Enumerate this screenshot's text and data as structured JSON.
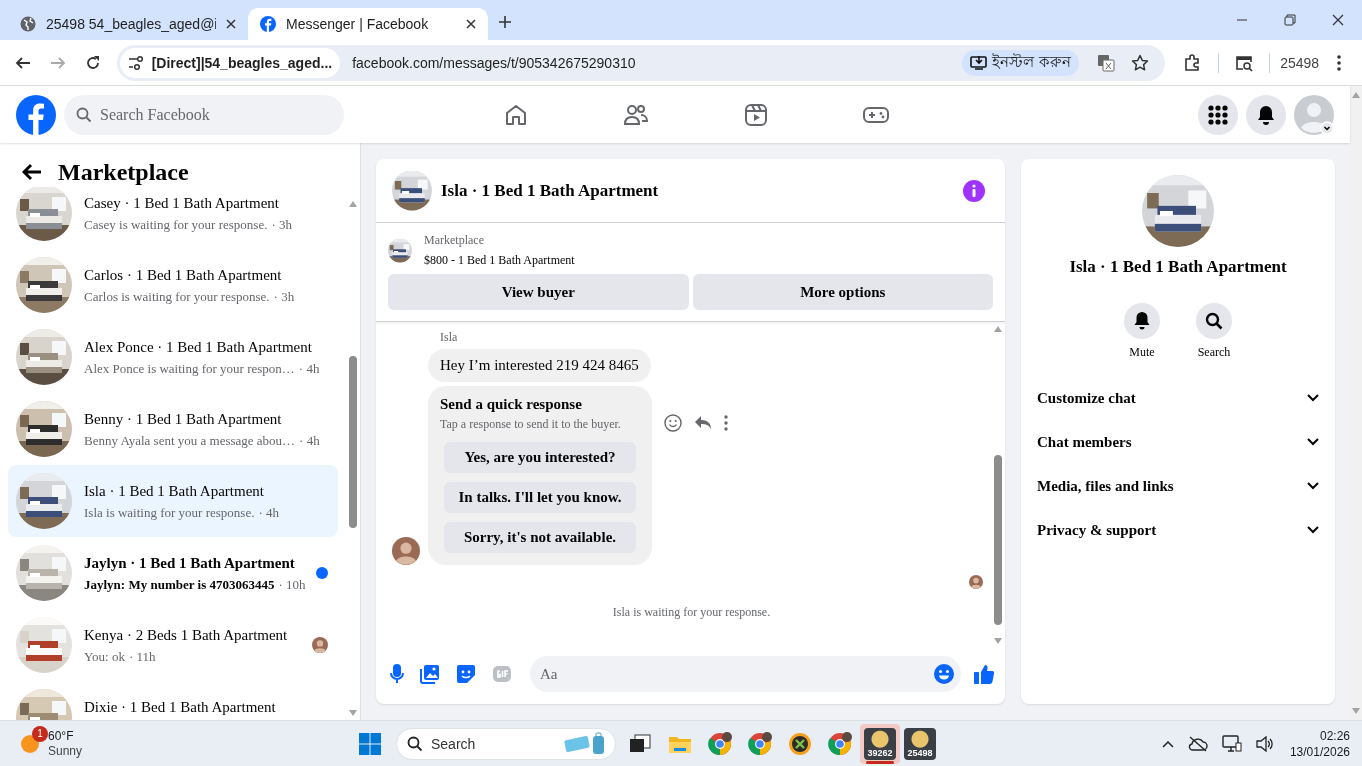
{
  "browser": {
    "tabs": [
      {
        "title": "25498 54_beagles_aged@i",
        "kind": "globe",
        "selected": false
      },
      {
        "title": "Messenger | Facebook",
        "kind": "site",
        "selected": true
      }
    ],
    "site_chip": "[Direct]|54_beagles_aged...",
    "url": "facebook.com/messages/t/905342675290310",
    "install_button": "ইনস্টল করুন",
    "profile_label": "25498"
  },
  "header": {
    "search": {
      "placeholder": "Search Facebook"
    }
  },
  "sidebar": {
    "title": "Marketplace",
    "conversations": [
      {
        "name": "Casey · 1 Bed 1 Bath Apartment",
        "preview": "Casey is waiting for your response.",
        "time": "· 3h",
        "selected": false,
        "unread": false,
        "seen": false
      },
      {
        "name": "Carlos · 1 Bed 1 Bath Apartment",
        "preview": "Carlos is waiting for your response.",
        "time": "· 3h",
        "selected": false,
        "unread": false,
        "seen": false
      },
      {
        "name": "Alex Ponce · 1 Bed 1 Bath Apartment",
        "preview": "Alex Ponce is waiting for your respon…",
        "time": "· 4h",
        "selected": false,
        "unread": false,
        "seen": false
      },
      {
        "name": "Benny · 1 Bed 1 Bath Apartment",
        "preview": "Benny Ayala sent you a message abou…",
        "time": "· 4h",
        "selected": false,
        "unread": false,
        "seen": false
      },
      {
        "name": "Isla · 1 Bed 1 Bath Apartment",
        "preview": "Isla is waiting for your response.",
        "time": "· 4h",
        "selected": true,
        "unread": false,
        "seen": false
      },
      {
        "name": "Jaylyn · 1 Bed 1 Bath Apartment",
        "preview": "Jaylyn: My number is 4703063445",
        "time": "· 10h",
        "selected": false,
        "unread": true,
        "seen": false
      },
      {
        "name": "Kenya · 2 Beds 1 Bath Apartment",
        "preview": "You: ok",
        "time": "· 11h",
        "selected": false,
        "unread": false,
        "seen": true
      },
      {
        "name": "Dixie · 1 Bed 1 Bath Apartment",
        "selected": false,
        "unread": false,
        "seen": false
      }
    ]
  },
  "chat": {
    "title": "Isla · 1 Bed 1 Bath Apartment",
    "listing": {
      "label": "Marketplace",
      "title": "$800 - 1 Bed 1 Bath Apartment"
    },
    "buttons": [
      "View buyer",
      "More options"
    ],
    "sender": "Isla",
    "message": "Hey I’m interested 219 424 8465",
    "quick_response": {
      "title": "Send a quick response",
      "subtitle": "Tap a response to send it to the buyer.",
      "options": [
        "Yes, are you interested?",
        "In talks. I'll let you know.",
        "Sorry, it's not available."
      ]
    },
    "status": "Isla is waiting for your response.",
    "composer": {
      "placeholder": "Aa"
    }
  },
  "info": {
    "title": "Isla · 1 Bed 1 Bath Apartment",
    "actions": [
      {
        "label": "Mute",
        "kind": "bell"
      },
      {
        "label": "Search",
        "kind": "search"
      }
    ],
    "sections": [
      {
        "label": "Customize chat",
        "expanded": false
      },
      {
        "label": "Chat members",
        "expanded": false
      },
      {
        "label": "Media, files and links",
        "expanded": false
      },
      {
        "label": "Privacy & support",
        "expanded": false
      }
    ]
  },
  "taskbar": {
    "weather": {
      "badge": "1",
      "temp": "60°F",
      "condition": "Sunny"
    },
    "search": {
      "placeholder": "Search"
    },
    "apps": [
      {
        "kind": "taskview",
        "selected": false
      },
      {
        "kind": "folder",
        "selected": false
      },
      {
        "kind": "browser",
        "selected": false
      },
      {
        "kind": "browser",
        "selected": false
      },
      {
        "kind": "ix",
        "selected": false
      },
      {
        "kind": "browser",
        "selected": false
      },
      {
        "kind": "badge",
        "label": "39262",
        "selected": true
      },
      {
        "kind": "badge",
        "label": "25498",
        "selected": false
      }
    ],
    "clock": {
      "time": "02:26",
      "date": "13/01/2026"
    }
  }
}
